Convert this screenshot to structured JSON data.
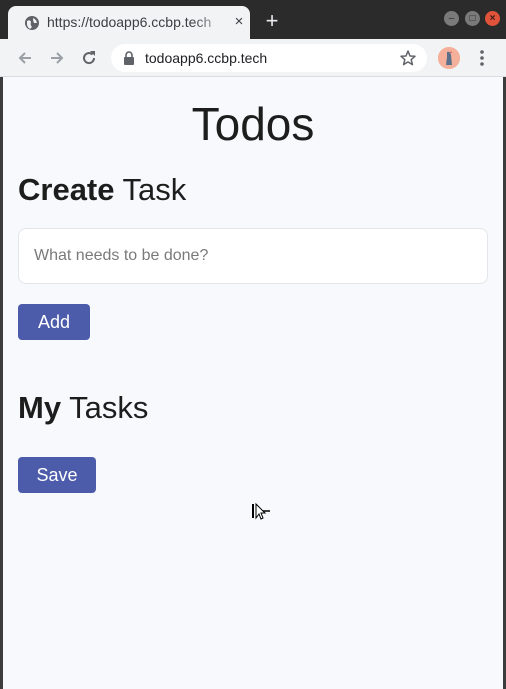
{
  "browser": {
    "tab_title": "https://todoapp6.ccbp.tech",
    "tab_close": "×",
    "new_tab": "+",
    "url": "todoapp6.ccbp.tech",
    "icons": [
      "globe-icon",
      "close-icon",
      "plus-icon",
      "back-icon",
      "forward-icon",
      "reload-icon",
      "lock-icon",
      "star-icon",
      "avatar",
      "more-vert-icon"
    ]
  },
  "page": {
    "title": "Todos",
    "create": {
      "bold": "Create",
      "rest": " Task"
    },
    "input_placeholder": "What needs to be done?",
    "add_label": "Add",
    "tasks": {
      "bold": "My",
      "rest": " Tasks"
    },
    "save_label": "Save"
  },
  "colors": {
    "background": "#f7f9fc",
    "button": "#4c5cab",
    "text": "#1d1d1d"
  }
}
